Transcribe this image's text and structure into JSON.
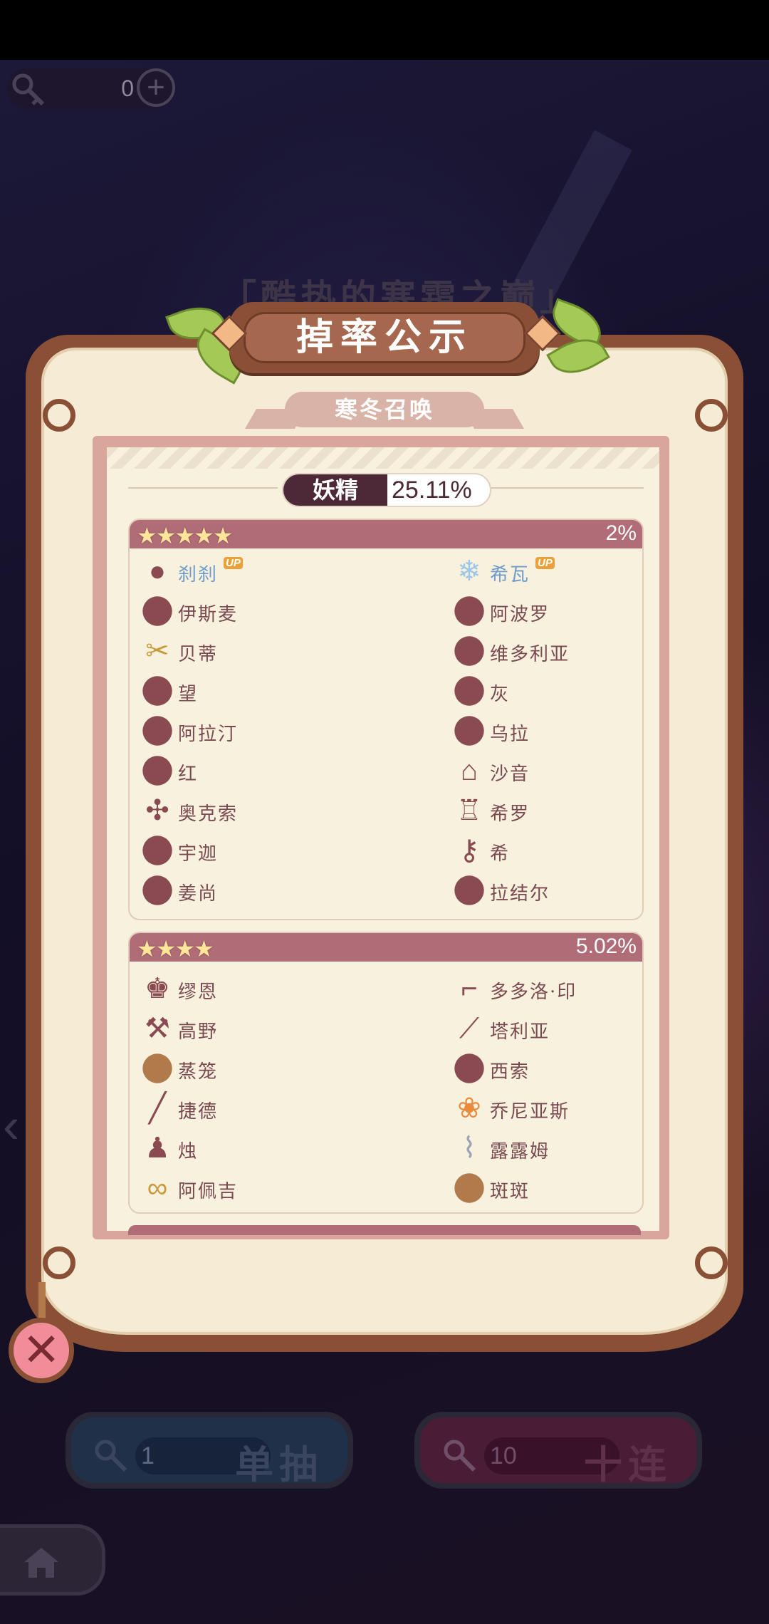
{
  "currency": {
    "amount": "0",
    "icon": "key-icon",
    "add_icon": "plus-icon"
  },
  "banner_title": "「酷热的寒霜之巅」",
  "dialog": {
    "title": "掉率公示",
    "subtitle": "寒冬召唤",
    "category": {
      "label": "妖精",
      "rate": "25.11%"
    },
    "up_tag": "UP",
    "five_star": {
      "stars": "★★★★★",
      "rate": "2%",
      "items": [
        {
          "name": "刹刹",
          "icon": "beads-icon",
          "up": true
        },
        {
          "name": "希瓦",
          "icon": "ice-crystal-icon",
          "up": true
        },
        {
          "name": "伊斯麦",
          "icon": "cloud-icon"
        },
        {
          "name": "阿波罗",
          "icon": "egg-icon"
        },
        {
          "name": "贝蒂",
          "icon": "scissors-icon"
        },
        {
          "name": "维多利亚",
          "icon": "leaf-icon"
        },
        {
          "name": "望",
          "icon": "microphone-icon"
        },
        {
          "name": "灰",
          "icon": "doll-icon"
        },
        {
          "name": "阿拉汀",
          "icon": "bird-icon"
        },
        {
          "name": "乌拉",
          "icon": "bottle-icon"
        },
        {
          "name": "红",
          "icon": "basket-icon"
        },
        {
          "name": "沙音",
          "icon": "birdcage-icon"
        },
        {
          "name": "奥克索",
          "icon": "pinwheel-icon"
        },
        {
          "name": "希罗",
          "icon": "lantern-icon"
        },
        {
          "name": "宇迦",
          "icon": "orb-icon"
        },
        {
          "name": "希",
          "icon": "key-icon"
        },
        {
          "name": "姜尚",
          "icon": "ball-icon"
        },
        {
          "name": "拉结尔",
          "icon": "bird-head-icon"
        }
      ]
    },
    "four_star": {
      "stars": "★★★★",
      "rate": "5.02%",
      "items": [
        {
          "name": "缪恩",
          "icon": "chess-king-icon"
        },
        {
          "name": "多多洛·印",
          "icon": "pipe-icon"
        },
        {
          "name": "高野",
          "icon": "hammer-icon"
        },
        {
          "name": "塔利亚",
          "icon": "sword-icon"
        },
        {
          "name": "蒸笼",
          "icon": "steamer-icon"
        },
        {
          "name": "西索",
          "icon": "ring-icon"
        },
        {
          "name": "捷德",
          "icon": "needle-icon"
        },
        {
          "name": "乔尼亚斯",
          "icon": "fruit-icon"
        },
        {
          "name": "烛",
          "icon": "candlestick-icon"
        },
        {
          "name": "露露姆",
          "icon": "test-tube-icon"
        },
        {
          "name": "阿佩吉",
          "icon": "glasses-icon"
        },
        {
          "name": "斑斑",
          "icon": "wood-log-icon"
        }
      ]
    }
  },
  "bottom": {
    "single": {
      "count": "1",
      "label": "单抽"
    },
    "ten": {
      "count": "10",
      "label": "十连"
    },
    "close_icon": "close-icon",
    "home_icon": "home-icon"
  },
  "colors": {
    "panel_border": "#8a5036",
    "panel_fill": "#f6ecd6",
    "tier_header": "#b06d78",
    "name_text": "#7a4a52",
    "up_name_text": "#6f9ccc",
    "category_pill": "#4d2938"
  }
}
